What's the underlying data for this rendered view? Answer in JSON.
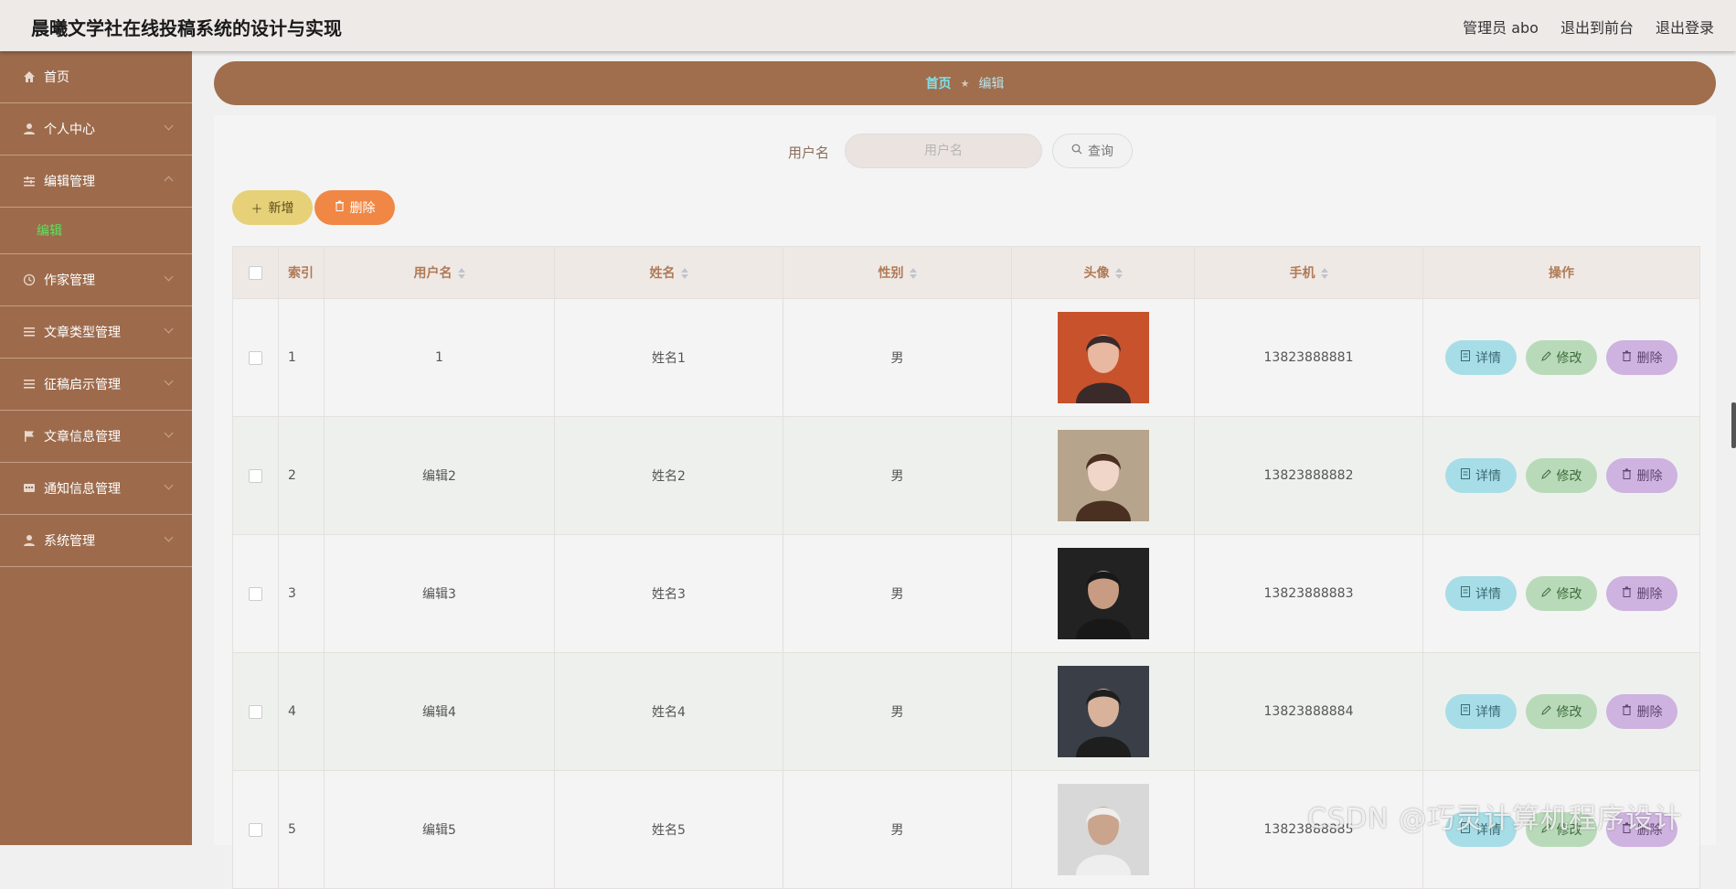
{
  "app": {
    "title": "晨曦文学社在线投稿系统的设计与实现",
    "user_label": "管理员 abo",
    "to_front": "退出到前台",
    "logout": "退出登录"
  },
  "sidebar": {
    "items": [
      {
        "label": "首页",
        "icon": "home-icon"
      },
      {
        "label": "个人中心",
        "icon": "user-icon"
      },
      {
        "label": "编辑管理",
        "icon": "sliders-icon",
        "expanded": true
      },
      {
        "label": "编辑",
        "sub": true,
        "active": true
      },
      {
        "label": "作家管理",
        "icon": "clock-icon"
      },
      {
        "label": "文章类型管理",
        "icon": "list-icon"
      },
      {
        "label": "征稿启示管理",
        "icon": "list-icon"
      },
      {
        "label": "文章信息管理",
        "icon": "flag-icon"
      },
      {
        "label": "通知信息管理",
        "icon": "message-icon"
      },
      {
        "label": "系统管理",
        "icon": "user-icon"
      }
    ]
  },
  "breadcrumb": {
    "home": "首页",
    "current": "编辑"
  },
  "search": {
    "label": "用户名",
    "placeholder": "用户名",
    "button": "查询"
  },
  "toolbar": {
    "add": "新增",
    "delete": "删除"
  },
  "table": {
    "headers": [
      "索引",
      "用户名",
      "姓名",
      "性别",
      "头像",
      "手机",
      "操作"
    ],
    "rows": [
      {
        "index": "1",
        "username": "1",
        "name": "姓名1",
        "gender": "男",
        "phone": "13823888881"
      },
      {
        "index": "2",
        "username": "编辑2",
        "name": "姓名2",
        "gender": "男",
        "phone": "13823888882"
      },
      {
        "index": "3",
        "username": "编辑3",
        "name": "姓名3",
        "gender": "男",
        "phone": "13823888883"
      },
      {
        "index": "4",
        "username": "编辑4",
        "name": "姓名4",
        "gender": "男",
        "phone": "13823888884"
      },
      {
        "index": "5",
        "username": "编辑5",
        "name": "姓名5",
        "gender": "男",
        "phone": "13823888885"
      }
    ],
    "actions": {
      "detail": "详情",
      "edit": "修改",
      "delete": "删除"
    }
  },
  "watermark": "CSDN @巧灵计算机程序设计",
  "colors": {
    "sidebar": "#9d6b4c",
    "breadcrumb": "#a06e4d",
    "add": "#e6d178",
    "delete": "#f08745",
    "detail": "#a7dde6",
    "edit": "#b8dab8",
    "row_delete": "#ceb2e0"
  }
}
